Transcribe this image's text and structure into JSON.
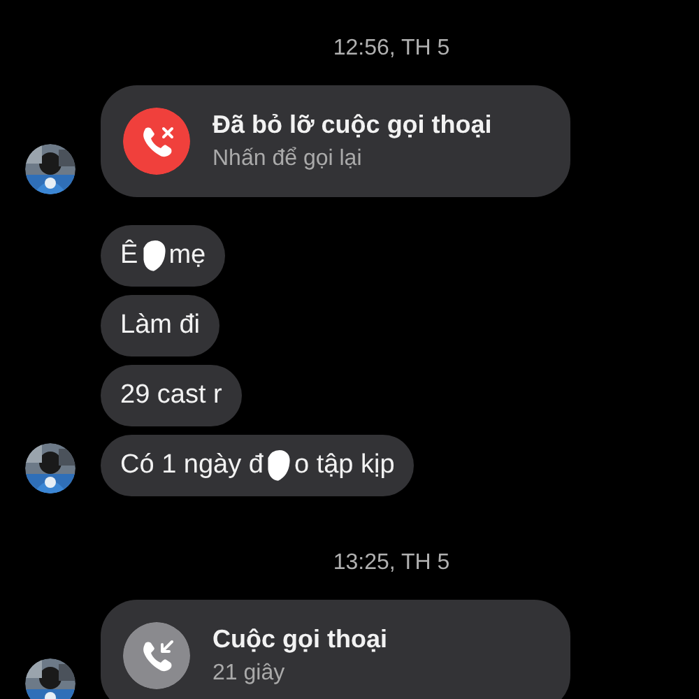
{
  "messages": [
    {
      "kind": "timestamp",
      "text": "12:56, TH 5"
    },
    {
      "kind": "call",
      "missed": true,
      "title": "Đã bỏ lỡ cuộc gọi thoại",
      "subtitle": "Nhấn để gọi lại",
      "avatar": true
    },
    {
      "kind": "text",
      "segments": [
        "Ê",
        "mẹ"
      ],
      "avatar": false
    },
    {
      "kind": "text",
      "segments": [
        "Làm đi"
      ],
      "avatar": false
    },
    {
      "kind": "text",
      "segments": [
        "29 cast r"
      ],
      "avatar": false
    },
    {
      "kind": "text",
      "segments": [
        "Có 1 ngày đ",
        "o tập kịp"
      ],
      "avatar": true
    },
    {
      "kind": "timestamp",
      "text": "13:25, TH 5"
    },
    {
      "kind": "call",
      "missed": false,
      "title": "Cuộc gọi thoại",
      "subtitle": "21 giây",
      "avatar": true
    }
  ]
}
